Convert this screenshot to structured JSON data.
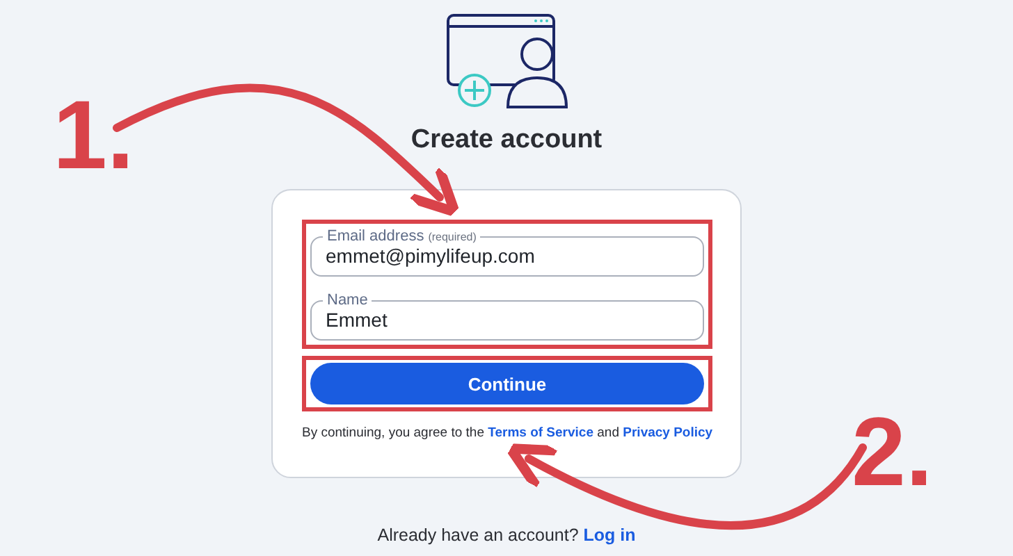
{
  "heading": "Create account",
  "fields": [
    {
      "label": "Email address",
      "hint": "(required)",
      "value": "emmet@pimylifeup.com"
    },
    {
      "label": "Name",
      "value": "Emmet"
    }
  ],
  "button": "Continue",
  "terms": {
    "text": "By continuing, you agree to the",
    "link1": "Terms of Service",
    "joiner": "and",
    "link2": "Privacy Policy"
  },
  "footer": {
    "text": "Already have an account?",
    "link": "Log in"
  },
  "annotations": [
    {
      "label": "1."
    },
    {
      "label": "2."
    }
  ]
}
